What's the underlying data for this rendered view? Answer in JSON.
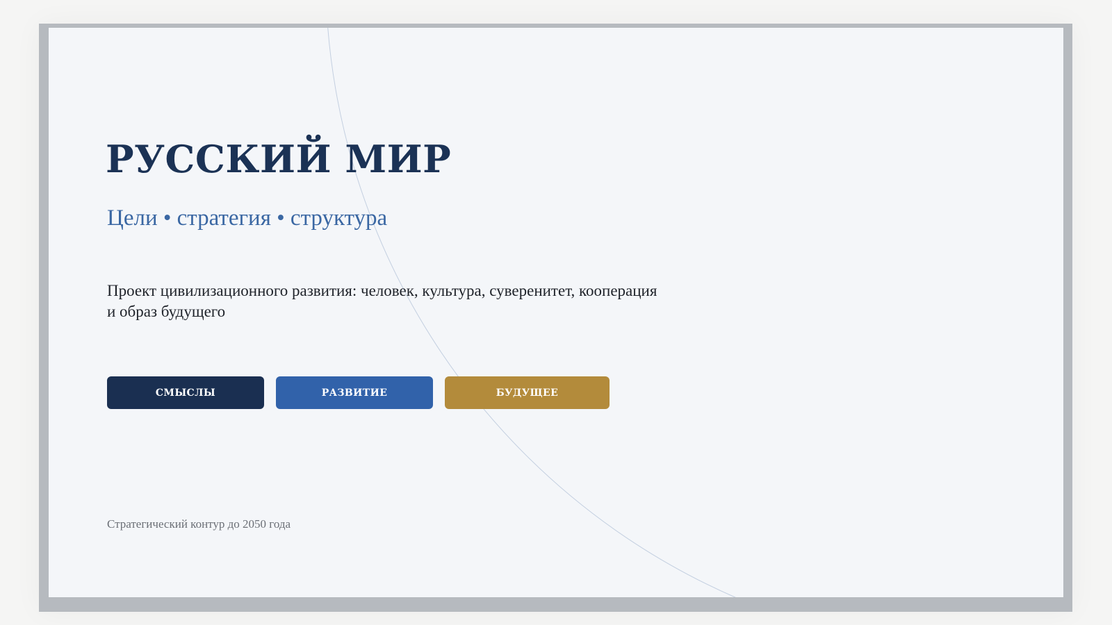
{
  "slide": {
    "title": "РУССКИЙ МИР",
    "subtitle": "Цели • стратегия • структура",
    "description": "Проект цивилизационного развития: человек, культура, суверенитет, кооперация и образ будущего",
    "buttons": {
      "meaning": "СМЫСЛЫ",
      "development": "РАЗВИТИЕ",
      "future": "БУДУЩЕЕ"
    },
    "footnote": "Стратегический контур до 2050 года"
  },
  "colors": {
    "title": "#1b3255",
    "subtitle": "#3a67a3",
    "button_meaning": "#1a2f51",
    "button_development": "#3162aa",
    "button_future": "#b38b3b",
    "slide_background": "#f4f6f9",
    "frame": "#b6babf"
  }
}
